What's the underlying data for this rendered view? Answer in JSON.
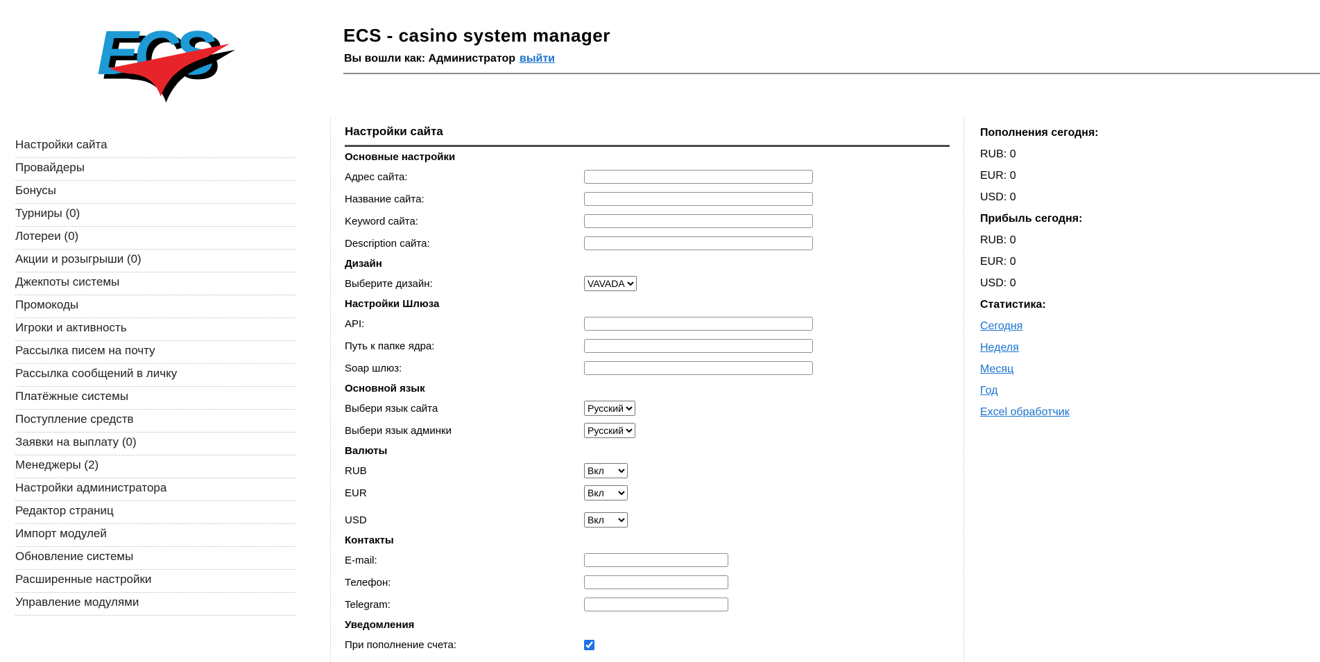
{
  "colors": {
    "link": "#1a73d1",
    "logo_blue": "#1e9ad6",
    "logo_red": "#e8242b",
    "rule_dark": "#4b4b4b",
    "rule_gray": "#8a8a8a",
    "checkbox_accent": "#1a73e8"
  },
  "header": {
    "logo_text": "ECS",
    "title": "ECS - casino system manager",
    "login_prefix": "Вы вошли как: Администратор",
    "logout_label": "выйти"
  },
  "sidebar": {
    "items": [
      "Настройки сайта",
      "Провайдеры",
      "Бонусы",
      "Турниры (0)",
      "Лотереи (0)",
      "Акции и розыгрыши (0)",
      "Джекпоты системы",
      "Промокоды",
      "Игроки и активность",
      "Рассылка писем на почту",
      "Рассылка сообщений в личку",
      "Платёжные системы",
      "Поступление средств",
      "Заявки на выплату (0)",
      "Менеджеры (2)",
      "Настройки администратора",
      "Редактор страниц",
      "Импорт модулей",
      "Обновление системы",
      "Расширенные настройки",
      "Управление модулями"
    ]
  },
  "main": {
    "title": "Настройки сайта"
  },
  "form": {
    "rows": [
      {
        "type": "heading",
        "label": "Основные настройки"
      },
      {
        "type": "text",
        "name": "site-address",
        "label": "Адрес сайта:",
        "value": ""
      },
      {
        "type": "text",
        "name": "site-name",
        "label": "Название сайта:",
        "value": ""
      },
      {
        "type": "text",
        "name": "site-keyword",
        "label": "Keyword сайта:",
        "value": ""
      },
      {
        "type": "text",
        "name": "site-description",
        "label": "Description сайта:",
        "value": ""
      },
      {
        "type": "heading",
        "label": "Дизайн"
      },
      {
        "type": "select",
        "name": "design",
        "label": "Выберите дизайн:",
        "value": "VAVADA"
      },
      {
        "type": "heading",
        "label": "Настройки Шлюза"
      },
      {
        "type": "text",
        "name": "api",
        "label": "API:",
        "value": ""
      },
      {
        "type": "text",
        "name": "core-folder-path",
        "label": "Путь к папке ядра:",
        "value": ""
      },
      {
        "type": "text",
        "name": "soap-gateway",
        "label": "Soap шлюз:",
        "value": ""
      },
      {
        "type": "heading",
        "label": "Основной язык"
      },
      {
        "type": "select",
        "name": "site-language",
        "label": "Выбери язык сайта",
        "value": "Русский"
      },
      {
        "type": "select",
        "name": "admin-language",
        "label": "Выбери язык админки",
        "value": "Русский"
      },
      {
        "type": "heading",
        "label": "Валюты"
      },
      {
        "type": "select",
        "name": "rub-status",
        "label": "RUB",
        "value": "Вкл"
      },
      {
        "type": "select",
        "name": "eur-status",
        "label": "EUR",
        "value": "Вкл",
        "gap": "lg"
      },
      {
        "type": "select",
        "name": "usd-status",
        "label": "USD",
        "value": "Вкл",
        "gap": "xl"
      },
      {
        "type": "heading",
        "label": "Контакты"
      },
      {
        "type": "text",
        "name": "email",
        "label": "E-mail:",
        "value": "",
        "narrow": true
      },
      {
        "type": "text",
        "name": "phone",
        "label": "Телефон:",
        "value": "",
        "narrow": true
      },
      {
        "type": "text",
        "name": "telegram",
        "label": "Telegram:",
        "value": "",
        "narrow": true
      },
      {
        "type": "heading",
        "label": "Уведомления"
      },
      {
        "type": "checkbox",
        "name": "deposit-notification",
        "label": "При пополнение счета:",
        "checked": true
      }
    ]
  },
  "stats": {
    "groups": [
      {
        "title": "Пополнения сегодня:",
        "rows": [
          {
            "label": "RUB:",
            "value": "0"
          },
          {
            "label": "EUR:",
            "value": "0"
          },
          {
            "label": "USD:",
            "value": "0"
          }
        ]
      },
      {
        "title": "Прибыль сегодня:",
        "rows": [
          {
            "label": "RUB:",
            "value": "0"
          },
          {
            "label": "EUR:",
            "value": "0"
          },
          {
            "label": "USD:",
            "value": "0"
          }
        ]
      }
    ],
    "statistics_title": "Статистика:",
    "links": [
      "Сегодня",
      "Неделя",
      "Месяц",
      "Год",
      "Excel обработчик"
    ]
  }
}
